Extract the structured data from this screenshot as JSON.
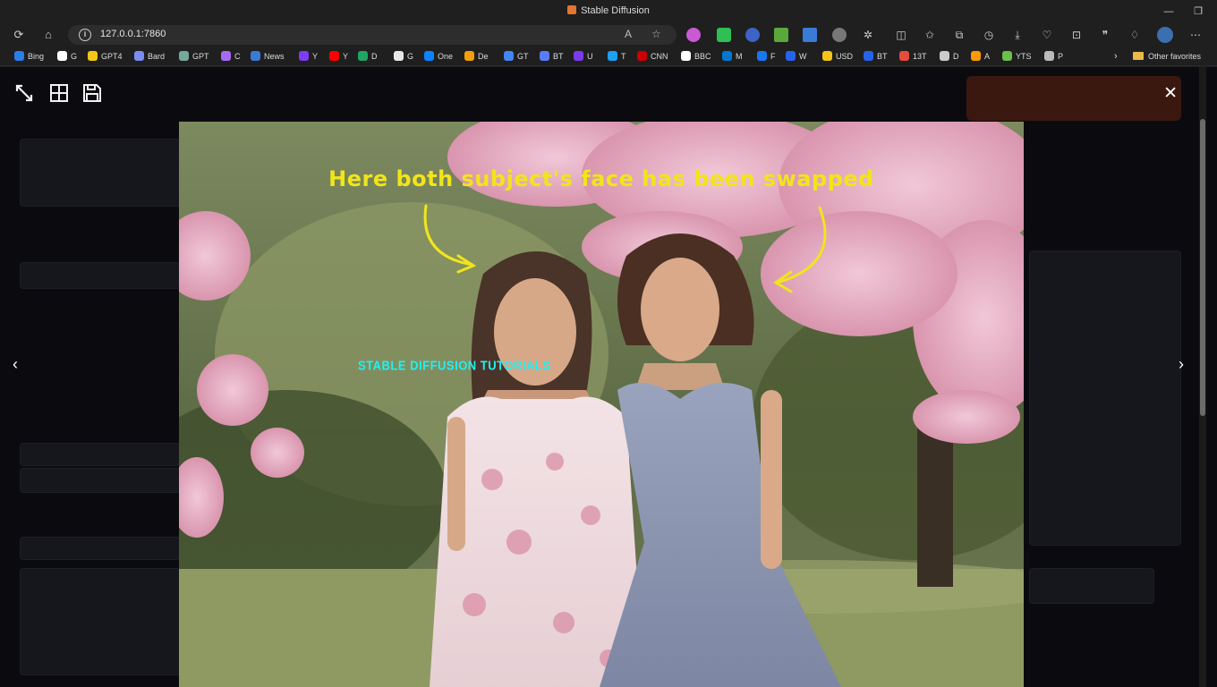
{
  "window": {
    "title": "Stable Diffusion",
    "minimize_icon": "minimize-icon",
    "restore_icon": "restore-icon"
  },
  "browser": {
    "url": "127.0.0.1:7860",
    "nav": [
      "refresh-icon",
      "home-icon"
    ],
    "bookmarks": [
      {
        "label": "Bing",
        "color": "#2b7de9"
      },
      {
        "label": "G",
        "color": "#ffffff"
      },
      {
        "label": "GPT4",
        "color": "#f5c518"
      },
      {
        "label": "Bard",
        "color": "#7b8cf5"
      },
      {
        "label": "GPT",
        "color": "#74aa9c"
      },
      {
        "label": "C",
        "color": "#a66bf5"
      },
      {
        "label": "News",
        "color": "#3a7bd5"
      },
      {
        "label": "Y",
        "color": "#7d3cf5"
      },
      {
        "label": "Y",
        "color": "#ff0000"
      },
      {
        "label": "D",
        "color": "#1fa463"
      },
      {
        "label": "G",
        "color": "#e8e8e8"
      },
      {
        "label": "One",
        "color": "#0a84ff"
      },
      {
        "label": "De",
        "color": "#f59e0b"
      },
      {
        "label": "GT",
        "color": "#4285f4"
      },
      {
        "label": "BT",
        "color": "#5b7cfa"
      },
      {
        "label": "U",
        "color": "#7c3aed"
      },
      {
        "label": "T",
        "color": "#1da1f2"
      },
      {
        "label": "CNN",
        "color": "#cc0000"
      },
      {
        "label": "BBC",
        "color": "#ffffff"
      },
      {
        "label": "M",
        "color": "#0078d4"
      },
      {
        "label": "F",
        "color": "#1877f2"
      },
      {
        "label": "W",
        "color": "#2563eb"
      },
      {
        "label": "USD",
        "color": "#f5c518"
      },
      {
        "label": "BT",
        "color": "#2563eb"
      },
      {
        "label": "13T",
        "color": "#e74c3c"
      },
      {
        "label": "D",
        "color": "#cccccc"
      },
      {
        "label": "A",
        "color": "#ff9900"
      },
      {
        "label": "YTS",
        "color": "#6abf4b"
      },
      {
        "label": "P",
        "color": "#bbbbbb"
      }
    ],
    "other_favorites": "Other favorites"
  },
  "lightbox": {
    "tools": [
      "fullscreen-icon",
      "grid-icon",
      "save-icon"
    ],
    "close_label": "✕",
    "prev_label": "‹",
    "next_label": "›",
    "image": {
      "caption": "Here both subject's face has been swapped",
      "watermark": "STABLE DIFFUSION TUTORIALS",
      "caption_color": "#f1e51b",
      "watermark_color": "#20f0f5"
    }
  }
}
